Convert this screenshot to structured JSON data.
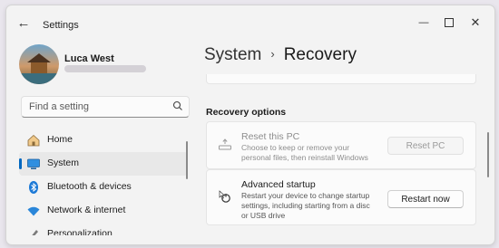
{
  "window": {
    "title": "Settings"
  },
  "user": {
    "name": "Luca West"
  },
  "search": {
    "placeholder": "Find a setting"
  },
  "sidebar": {
    "items": [
      {
        "label": "Home",
        "icon": "home-icon"
      },
      {
        "label": "System",
        "icon": "monitor-icon",
        "selected": true
      },
      {
        "label": "Bluetooth & devices",
        "icon": "bluetooth-icon"
      },
      {
        "label": "Network & internet",
        "icon": "wifi-icon"
      },
      {
        "label": "Personalization",
        "icon": "brush-icon"
      }
    ]
  },
  "breadcrumb": {
    "parent": "System",
    "separator": "›",
    "current": "Recovery"
  },
  "recovery": {
    "section_title": "Recovery options",
    "options": [
      {
        "title": "Reset this PC",
        "description": "Choose to keep or remove your personal files, then reinstall Windows",
        "button": "Reset PC",
        "enabled": false
      },
      {
        "title": "Advanced startup",
        "description": "Restart your device to change startup settings, including starting from a disc or USB drive",
        "button": "Restart now",
        "enabled": true
      }
    ]
  },
  "colors": {
    "accent": "#0067c0",
    "window_bg": "#f3f3f3",
    "card_bg": "#fbfbfb"
  }
}
